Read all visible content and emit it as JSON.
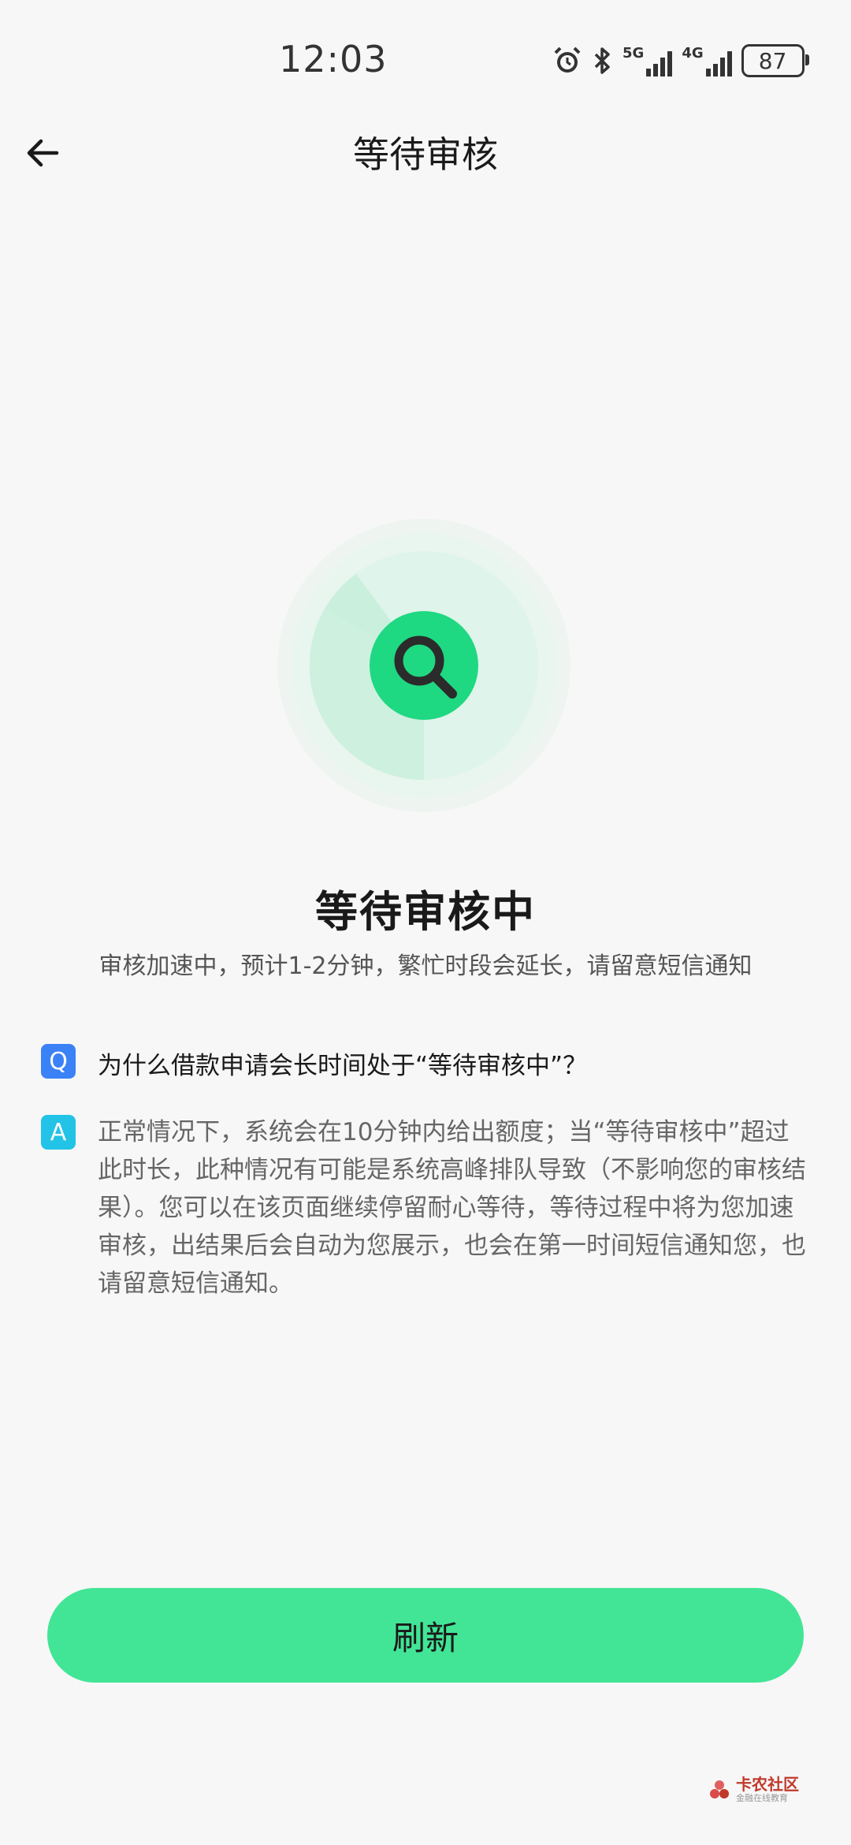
{
  "status_bar": {
    "time": "12:03",
    "battery": "87",
    "network_1": "5G",
    "network_2": "4G",
    "icons": [
      "alarm-icon",
      "bluetooth-icon",
      "signal-5g-icon",
      "signal-4g-icon",
      "battery-icon"
    ]
  },
  "header": {
    "title": "等待审核",
    "back_icon": "arrow-left-icon"
  },
  "status": {
    "icon": "search-icon",
    "title": "等待审核中",
    "subtitle": "审核加速中，预计1-2分钟，繁忙时段会延长，请留意短信通知"
  },
  "faq": {
    "q_badge": "Q",
    "question": "为什么借款申请会长时间处于“等待审核中”？",
    "a_badge": "A",
    "answer_lines": [
      "正常情况下，系统会在10分钟内给出额度；当“等待审核中”超过",
      "此时长，此种情况有可能是系统高峰排队导致（不影响您的审核结",
      "果）。您可以在该页面继续停留耐心等待，等待过程中将为您加速",
      "审核，出结果后会自动为您展示，也会在第一时间短信通知您，也",
      "请留意短信通知。"
    ]
  },
  "actions": {
    "refresh_label": "刷新"
  },
  "watermark": {
    "main": "卡农社区",
    "sub": "金融在线教育"
  },
  "colors": {
    "accent": "#42e596",
    "icon_green": "#1fd882",
    "q_badge": "#3b82f6",
    "a_badge": "#22c3e6",
    "background": "#f7f7f7"
  }
}
